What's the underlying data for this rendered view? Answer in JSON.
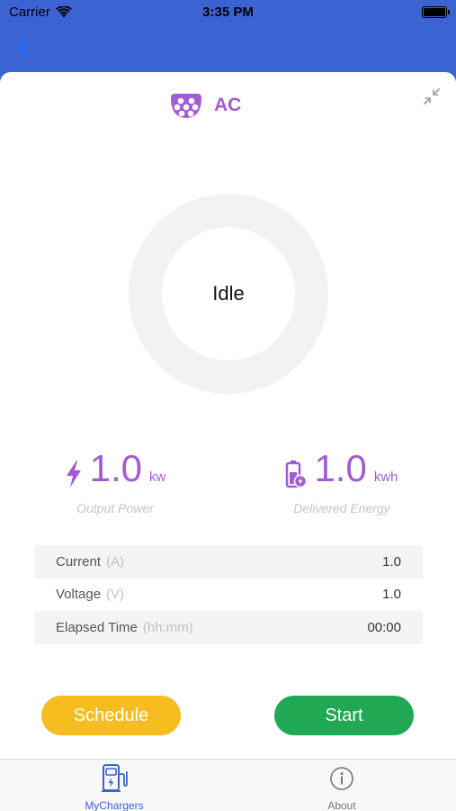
{
  "status_bar": {
    "carrier": "Carrier",
    "time": "3:35 PM"
  },
  "connector": {
    "type_label": "AC"
  },
  "status": {
    "state": "Idle"
  },
  "output_power": {
    "value": "1.0",
    "unit": "kw",
    "caption": "Output Power"
  },
  "delivered_energy": {
    "value": "1.0",
    "unit": "kwh",
    "caption": "Delivered Energy"
  },
  "details": [
    {
      "label": "Current",
      "unit": "(A)",
      "value": "1.0"
    },
    {
      "label": "Voltage",
      "unit": "(V)",
      "value": "1.0"
    },
    {
      "label": "Elapsed Time",
      "unit": "(hh:mm)",
      "value": "00:00"
    }
  ],
  "actions": {
    "schedule_label": "Schedule",
    "start_label": "Start"
  },
  "tabs": [
    {
      "label": "MyChargers",
      "icon": "charger-station-icon"
    },
    {
      "label": "About",
      "icon": "info-icon"
    }
  ],
  "colors": {
    "nav_blue": "#3b63d2",
    "accent_purple": "#a35bd3",
    "schedule_yellow": "#f5bd1f",
    "start_green": "#21a853"
  }
}
